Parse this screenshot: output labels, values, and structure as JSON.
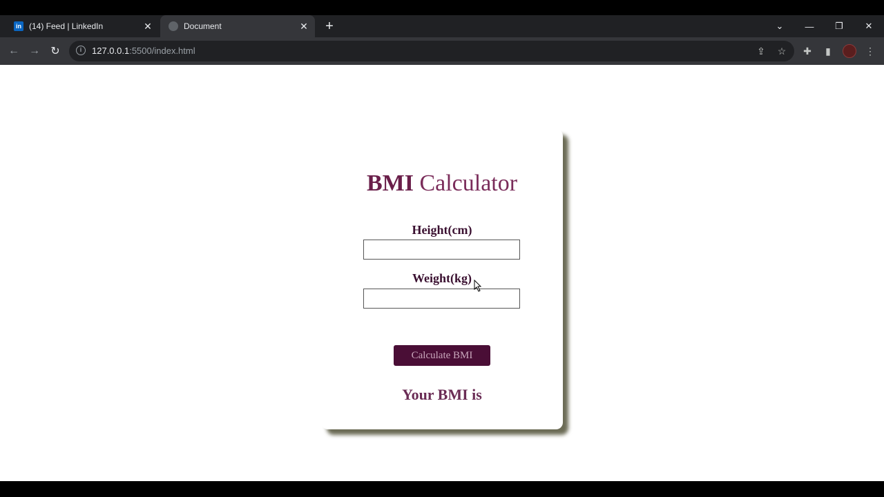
{
  "tabs": [
    {
      "title": "(14) Feed | LinkedIn",
      "favicon": "linkedin-icon"
    },
    {
      "title": "Document",
      "favicon": "globe-icon"
    }
  ],
  "address": {
    "host": "127.0.0.1",
    "rest": ":5500/index.html"
  },
  "page": {
    "title_bold": "BMI",
    "title_rest": " Calculator",
    "height_label": "Height(cm)",
    "height_value": "",
    "weight_label": "Weight(kg)",
    "weight_value": "",
    "button_label": "Calculate BMI",
    "result_text": "Your BMI is"
  },
  "colors": {
    "accent": "#4a0e36",
    "title": "#7a2c5a"
  }
}
